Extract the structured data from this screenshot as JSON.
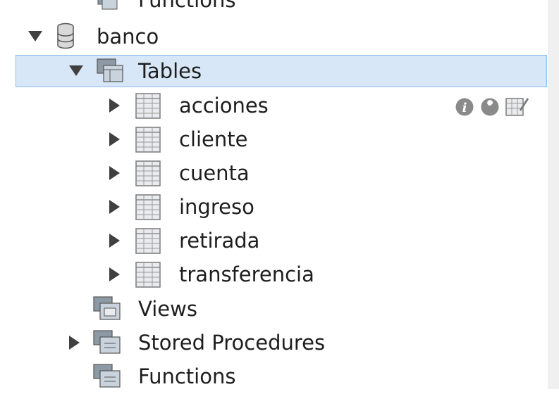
{
  "schema_tree": {
    "top_partial": {
      "label": "Functions"
    },
    "schema": {
      "label": "banco",
      "expanded": true
    },
    "tables_group": {
      "label": "Tables",
      "expanded": true,
      "selected": true
    },
    "tables": [
      {
        "label": "acciones"
      },
      {
        "label": "cliente"
      },
      {
        "label": "cuenta"
      },
      {
        "label": "ingreso"
      },
      {
        "label": "retirada"
      },
      {
        "label": "transferencia"
      }
    ],
    "views_group": {
      "label": "Views"
    },
    "procedures_group": {
      "label": "Stored Procedures"
    },
    "functions_group": {
      "label": "Functions"
    },
    "row_actions": [
      "info-icon",
      "wrench-icon",
      "table-edit-icon"
    ]
  },
  "colors": {
    "selection_bg": "#d7e7f8",
    "selection_border": "#8dbde9",
    "text": "#1e1e1e",
    "icon_gray": "#7a7a7a"
  }
}
